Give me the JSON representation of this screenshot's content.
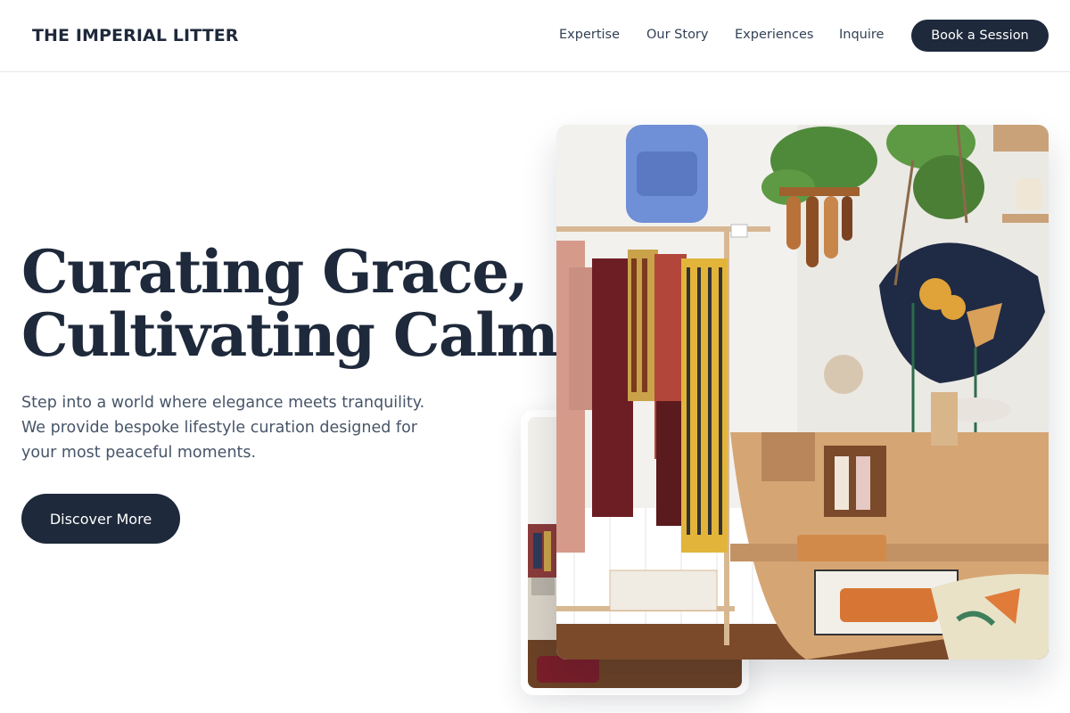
{
  "brand": "THE IMPERIAL LITTER",
  "nav": {
    "links": [
      "Expertise",
      "Our Story",
      "Experiences",
      "Inquire"
    ],
    "cta": "Book a Session"
  },
  "hero": {
    "headline_line1": "Curating Grace,",
    "headline_line2": "Cultivating Calm.",
    "lede": "Step into a world where elegance meets tranquility. We provide bespoke lifestyle curation designed for your most peaceful moments.",
    "button": "Discover More"
  },
  "colors": {
    "primary": "#1e293b",
    "text_muted": "#475569",
    "background": "#ffffff"
  }
}
